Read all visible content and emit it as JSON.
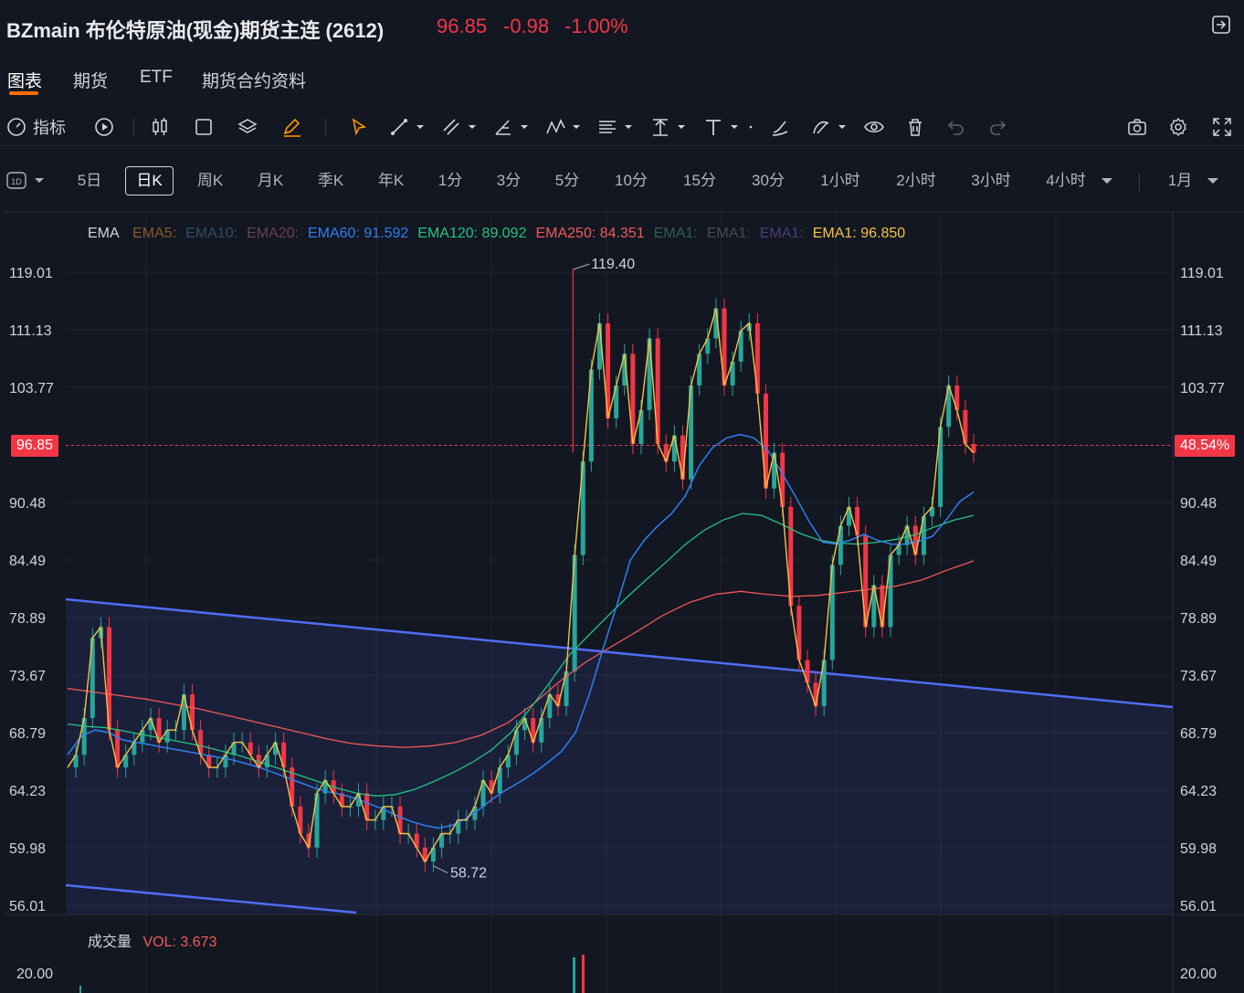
{
  "header": {
    "title": "BZmain 布伦特原油(现金)期货主连 (2612)",
    "last": "96.85",
    "change": "-0.98",
    "change_pct": "-1.00%"
  },
  "tabs": [
    "图表",
    "期货",
    "ETF",
    "期货合约资料"
  ],
  "toolbar": {
    "indicator_label": "指标"
  },
  "timeframes": {
    "interval_icon": "1D",
    "items": [
      "5日",
      "日K",
      "周K",
      "月K",
      "季K",
      "年K",
      "1分",
      "3分",
      "5分",
      "10分",
      "15分",
      "30分",
      "1小时",
      "2小时",
      "3小时",
      "4小时"
    ],
    "active": "日K",
    "range": "1月"
  },
  "colors": {
    "up": "#26a69a",
    "down": "#f23645",
    "ema60": "#2f7ff0",
    "ema120": "#26c281",
    "ema250": "#ef5a5a",
    "ema1": "#f5c242",
    "channel": "#4f6df5"
  },
  "chart_data": {
    "type": "line",
    "title": "",
    "y_axis_labels": [
      "119.01",
      "111.13",
      "103.77",
      "96.85",
      "90.48",
      "84.49",
      "78.89",
      "73.67",
      "68.79",
      "64.23",
      "59.98",
      "56.01"
    ],
    "right_axis_labels": [
      "119.01",
      "111.13",
      "103.77",
      "48.54%",
      "90.48",
      "84.49",
      "78.89",
      "73.67",
      "68.79",
      "64.23",
      "59.98",
      "56.01"
    ],
    "log_scale": true,
    "last_price": 96.85,
    "last_price_label": "96.85",
    "last_pct_label": "48.54%",
    "high_marker": {
      "value": 119.4,
      "label": "119.40"
    },
    "low_marker": {
      "value": 58.72,
      "label": "58.72"
    },
    "legend": {
      "title": "EMA",
      "items": [
        {
          "label": "EMA5:",
          "value": "",
          "color": "#8a5a2b"
        },
        {
          "label": "EMA10:",
          "value": "",
          "color": "#2f4e64"
        },
        {
          "label": "EMA20:",
          "value": "",
          "color": "#6b3d5a"
        },
        {
          "label": "EMA60:",
          "value": "91.592",
          "color": "#2f7ff0"
        },
        {
          "label": "EMA120:",
          "value": "89.092",
          "color": "#26c281"
        },
        {
          "label": "EMA250:",
          "value": "84.351",
          "color": "#ef5a5a"
        },
        {
          "label": "EMA1:",
          "value": "",
          "color": "#2f5c55"
        },
        {
          "label": "EMA1:",
          "value": "",
          "color": "#4a4a4a"
        },
        {
          "label": "EMA1:",
          "value": "",
          "color": "#4b3d7a"
        },
        {
          "label": "EMA1:",
          "value": "96.850",
          "color": "#f5c242"
        }
      ]
    },
    "close_series": [
      66,
      67,
      70,
      77,
      78,
      69,
      66,
      67,
      68,
      69,
      70,
      68,
      69,
      69,
      72,
      69,
      67,
      66,
      66,
      67,
      68,
      68,
      67,
      66,
      67,
      68,
      66,
      63,
      61,
      60,
      64,
      65,
      64,
      63,
      63,
      64,
      62,
      62,
      63,
      63,
      61,
      61,
      60,
      59,
      60,
      61,
      61,
      62,
      62,
      63,
      65,
      64,
      66,
      67,
      69,
      70,
      68,
      70,
      72,
      71,
      74,
      85,
      95,
      106,
      112,
      100,
      104,
      108,
      97,
      101,
      110,
      97,
      95,
      98,
      93,
      104,
      108,
      110,
      114,
      104,
      107,
      111,
      112,
      103,
      92,
      96,
      90,
      80,
      75,
      73,
      71,
      75,
      84,
      88,
      90,
      87,
      78,
      82,
      78,
      85,
      86,
      88,
      85,
      89,
      90,
      99,
      104,
      101,
      97,
      96
    ],
    "ema60": [
      67,
      68.5,
      69,
      68.8,
      68.2,
      68,
      67.8,
      67.6,
      67.4,
      67.2,
      67,
      66.8,
      66.6,
      66.3,
      66,
      65.6,
      65.2,
      64.8,
      64.4,
      64.1,
      63.9,
      63.6,
      63.2,
      62.8,
      62.3,
      61.9,
      61.6,
      61.4,
      61.6,
      62.1,
      62.8,
      63.6,
      64.3,
      64.9,
      65.6,
      66.4,
      67.3,
      68.8,
      72,
      76,
      80,
      84.5,
      86.5,
      88,
      89.3,
      91.2,
      94.5,
      96.6,
      97.7,
      98.1,
      97.7,
      96.3,
      93.8,
      91.2,
      88.5,
      86.3,
      86.1,
      86.5,
      87.1,
      86.5,
      86.1,
      86.1,
      86.4,
      86.9,
      88.6,
      90.6,
      91.6
    ],
    "ema120": [
      69.5,
      69.3,
      69.2,
      68.9,
      68.6,
      68.3,
      68.0,
      67.7,
      67.3,
      66.9,
      66.4,
      65.9,
      65.4,
      64.9,
      64.4,
      64.0,
      63.8,
      63.9,
      64.3,
      64.9,
      65.6,
      66.4,
      67.4,
      68.8,
      70.8,
      73,
      75.4,
      77.2,
      79,
      80.8,
      82.5,
      84.2,
      86,
      87.5,
      88.6,
      89.3,
      89.1,
      88.2,
      87.2,
      86.5,
      86.2,
      86.1,
      86.3,
      86.6,
      87.1,
      87.9,
      88.6,
      89.1
    ],
    "ema250": [
      72.5,
      72.2,
      71.9,
      71.6,
      71.2,
      70.8,
      70.3,
      69.8,
      69.3,
      68.8,
      68.3,
      67.9,
      67.7,
      67.6,
      67.7,
      68.0,
      68.6,
      69.6,
      71.2,
      73.1,
      74.8,
      76.2,
      77.6,
      79.1,
      80.3,
      81.1,
      81.4,
      81.1,
      80.9,
      81.0,
      81.3,
      81.6,
      81.9,
      82.5,
      83.5,
      84.4
    ],
    "volume_axis_label": "20.00",
    "volume_legend": {
      "title": "成交量",
      "label": "VOL:",
      "value": "3.673"
    }
  }
}
